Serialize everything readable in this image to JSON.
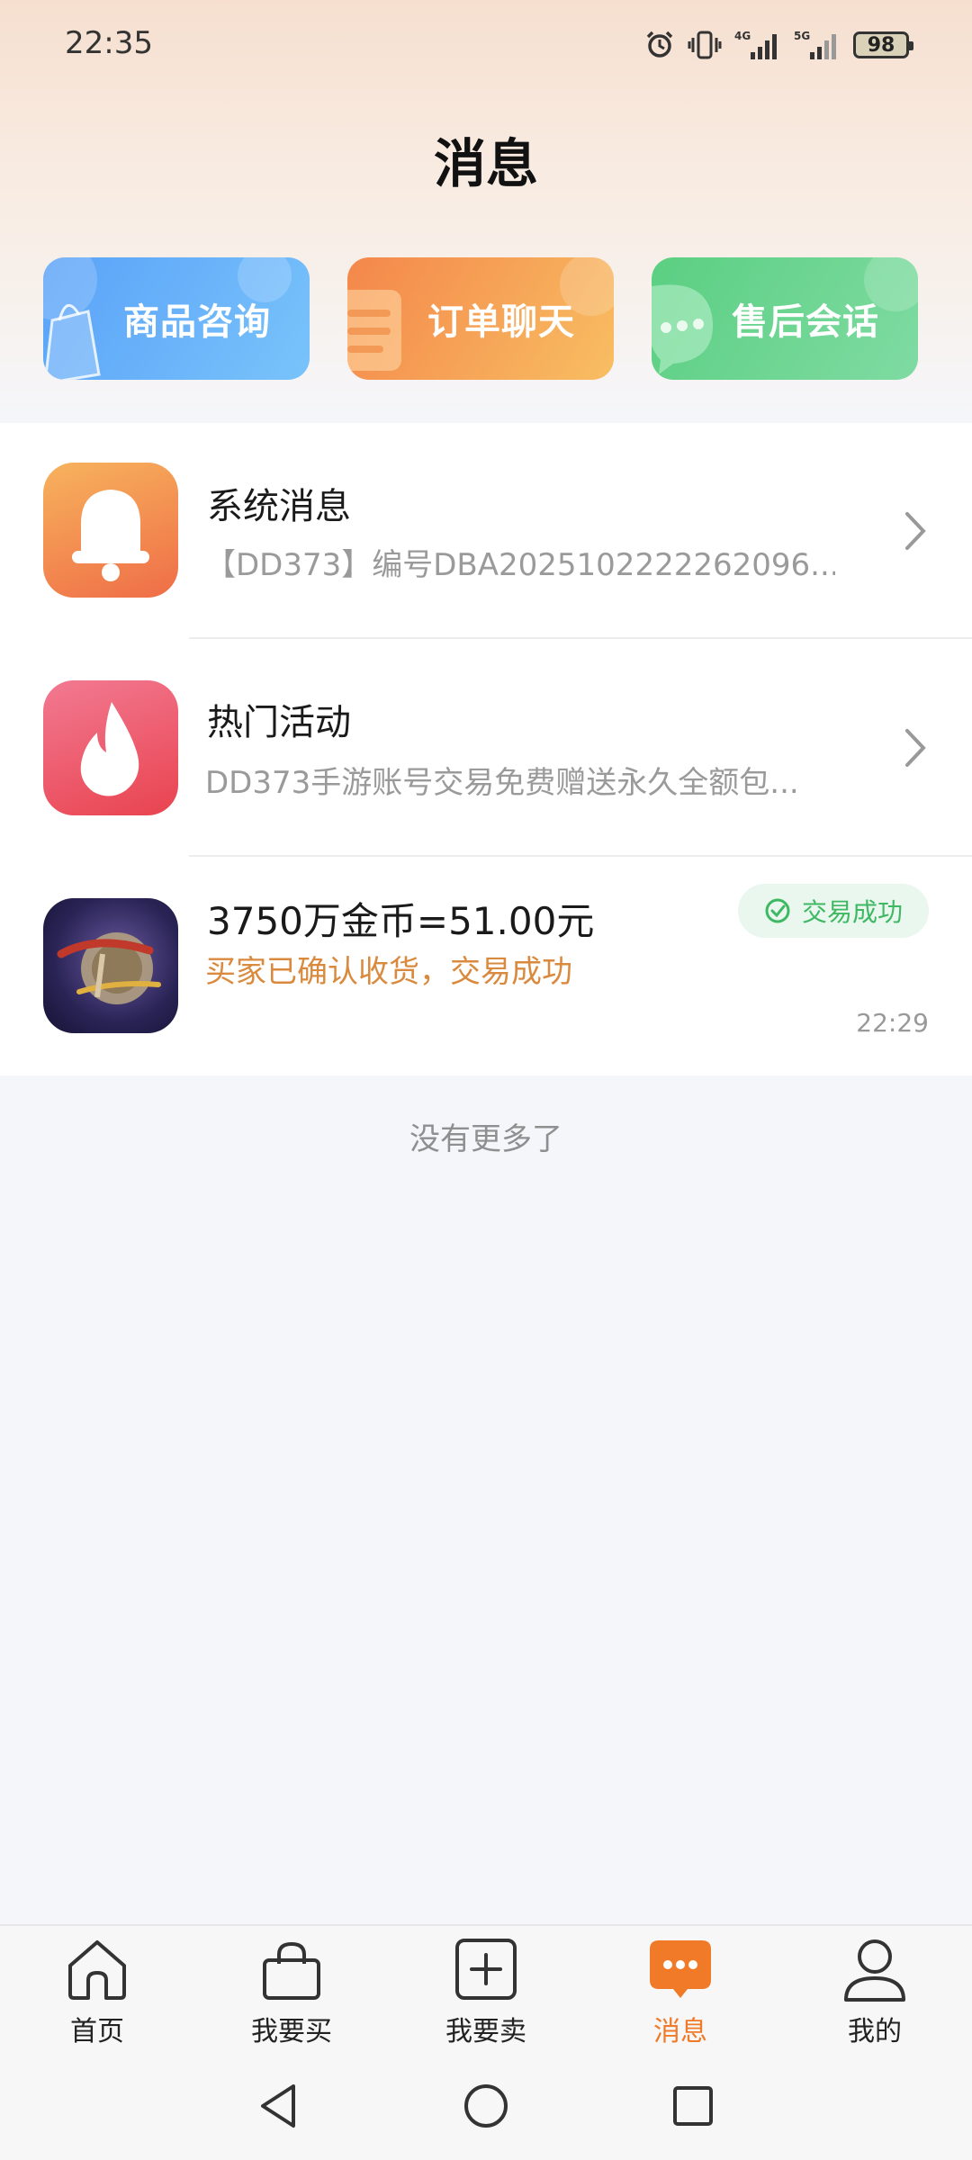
{
  "status_bar": {
    "time": "22:35",
    "network_1": "4G",
    "network_2": "5G",
    "battery": "98",
    "icons": [
      "alarm-icon",
      "vibrate-icon",
      "signal-4g-icon",
      "signal-5g-icon",
      "battery-icon"
    ]
  },
  "header": {
    "title": "消息"
  },
  "quick_tabs": [
    {
      "label": "商品咨询",
      "icon": "shopping-bag-icon",
      "color": "#5aa2f8"
    },
    {
      "label": "订单聊天",
      "icon": "order-note-icon",
      "color": "#f4874b"
    },
    {
      "label": "售后会话",
      "icon": "chat-bubble-icon",
      "color": "#5bcf82"
    }
  ],
  "messages": {
    "system": {
      "title": "系统消息",
      "subtitle": "【DD373】编号DBA2025102222262096...",
      "icon": "bell-icon",
      "color": "#f08a4b"
    },
    "activity": {
      "title": "热门活动",
      "subtitle": "DD373手游账号交易免费赠送永久全额包...",
      "icon": "flame-icon",
      "color": "#ec5766"
    },
    "order": {
      "title": "3750万金币=51.00元",
      "subtitle": "买家已确认收货，交易成功",
      "status": "交易成功",
      "time": "22:29",
      "icon": "game-dnf-icon"
    }
  },
  "list_footer": "没有更多了",
  "bottom_nav": {
    "items": [
      {
        "label": "首页",
        "icon": "home-icon"
      },
      {
        "label": "我要买",
        "icon": "bag-icon"
      },
      {
        "label": "我要卖",
        "icon": "plus-box-icon"
      },
      {
        "label": "消息",
        "icon": "message-icon",
        "active": true
      },
      {
        "label": "我的",
        "icon": "user-icon"
      }
    ],
    "active_color": "#f07a28"
  },
  "system_nav": [
    "back-icon",
    "home-circle-icon",
    "recents-icon"
  ]
}
